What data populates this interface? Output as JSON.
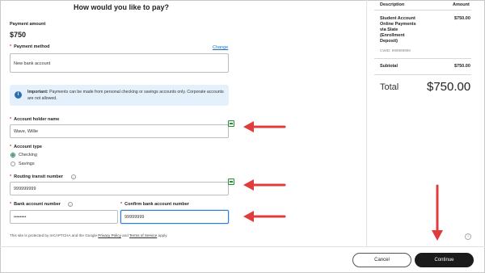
{
  "page_title": "How would you like to pay?",
  "payment_amount": {
    "label": "Payment amount",
    "value": "$750"
  },
  "payment_method": {
    "label": "Payment method",
    "change_link": "Change",
    "value": "New bank account"
  },
  "info_box": {
    "icon": "info-icon",
    "bold": "Important:",
    "text": "Payments can be made from personal checking or savings accounts only. Corporate accounts are not allowed."
  },
  "account_holder": {
    "label": "Account holder name",
    "value": "Wave, Willie"
  },
  "account_type": {
    "label": "Account type",
    "options": [
      "Checking",
      "Savings"
    ],
    "selected": "Checking"
  },
  "routing": {
    "label": "Routing transit number",
    "value": "999999999"
  },
  "bank_account": {
    "label": "Bank account number",
    "value": "••••••••"
  },
  "confirm_account": {
    "label": "Confirm bank account number",
    "value": "99999999"
  },
  "legal": {
    "prefix": "This site is protected by reCAPTCHA and the Google ",
    "privacy": "Privacy Policy",
    "and": " and ",
    "terms": "Terms of Service",
    "suffix": " apply."
  },
  "summary": {
    "col_description": "Description",
    "col_amount": "Amount",
    "item_lines": [
      "Student Account",
      "Online Payments",
      "via Slate",
      "(Enrollment",
      "Deposit)"
    ],
    "item_amount": "$750.00",
    "item_meta": "CWID: 999999999",
    "subtotal_label": "Subtotal",
    "subtotal_value": "$750.00",
    "total_label": "Total",
    "total_value": "$750.00"
  },
  "footer": {
    "cancel": "Cancel",
    "continue": "Continue"
  },
  "colors": {
    "accent_arrow": "#e03c3c",
    "required": "#d83b3b",
    "info_bg": "#e4f0fb",
    "primary_button": "#1b1b1b"
  }
}
